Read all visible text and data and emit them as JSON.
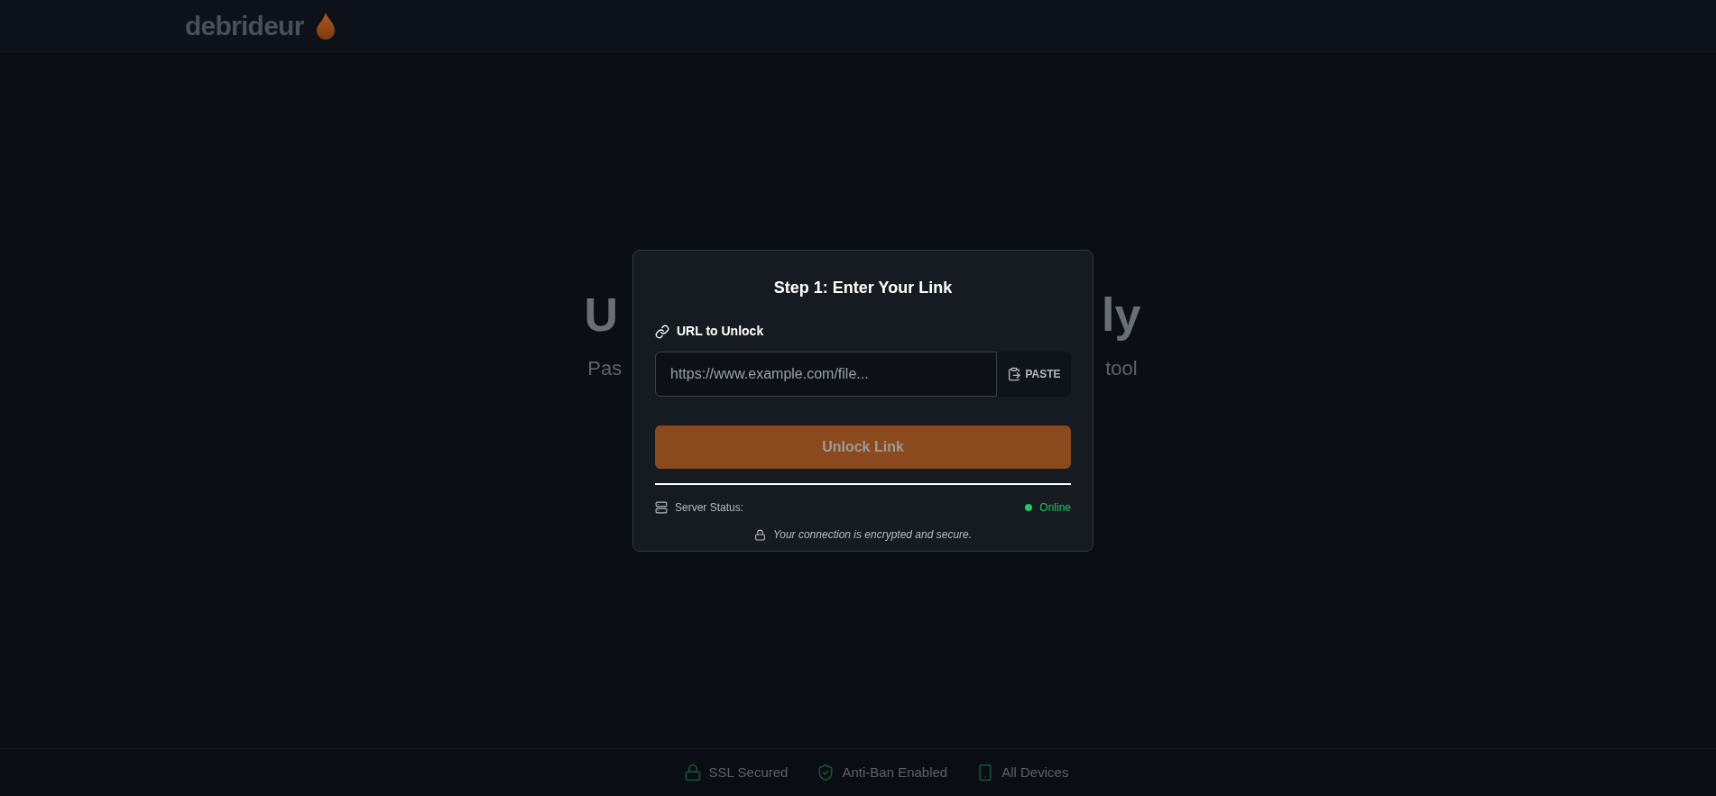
{
  "header": {
    "logo": "debrideur"
  },
  "hero": {
    "title_fragments": [
      "U",
      "ly"
    ],
    "subtitle_fragments": [
      "Pas",
      "tool"
    ]
  },
  "dialog": {
    "title": "Step 1: Enter Your Link",
    "field_label": "URL to Unlock",
    "url_field": {
      "placeholder": "https://www.example.com/file..."
    },
    "paste_button": "PASTE",
    "submit_button": {
      "label": "Unlock Link",
      "disabled": true
    },
    "server_status": {
      "label": "Server Status:",
      "value": "Online"
    },
    "security_note": "Your connection is encrypted and secure."
  },
  "footer": {
    "badges": [
      {
        "kind": "lock",
        "label": "SSL Secured"
      },
      {
        "kind": "shield",
        "label": "Anti-Ban Enabled"
      },
      {
        "kind": "device",
        "label": "All Devices"
      }
    ]
  }
}
